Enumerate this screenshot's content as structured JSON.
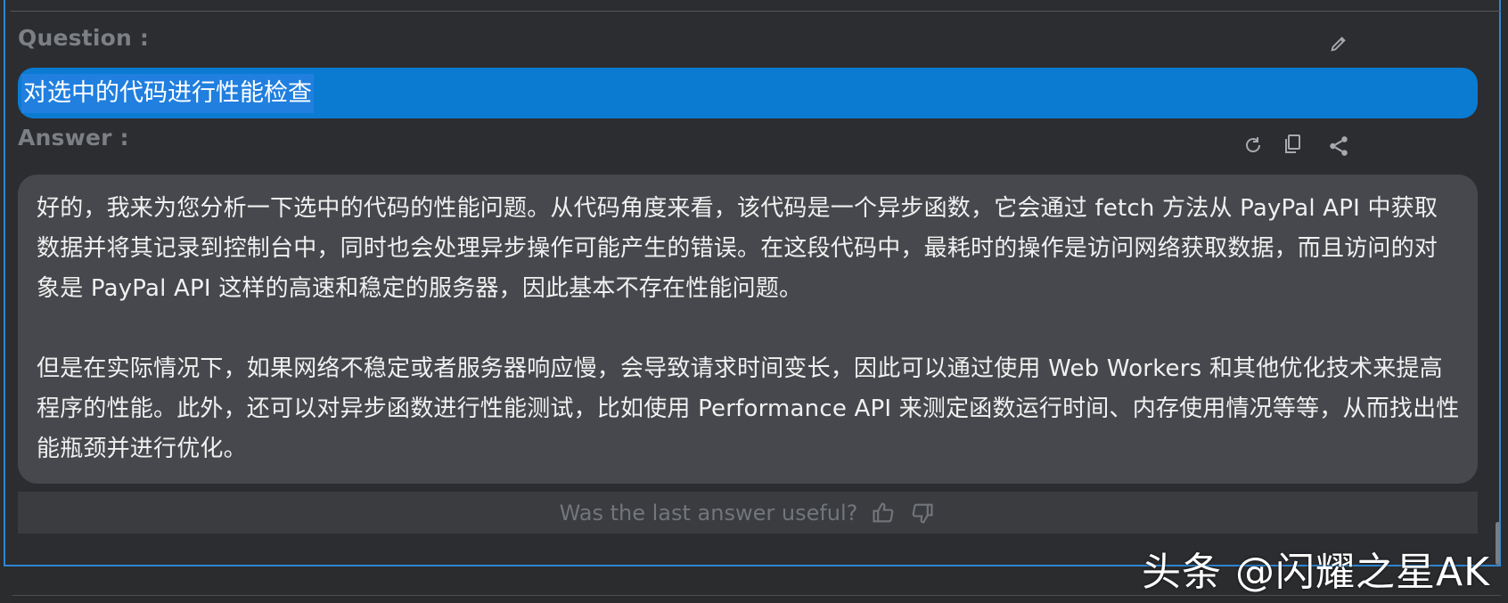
{
  "question": {
    "label": "Question :",
    "text": "对选中的代码进行性能检查"
  },
  "answer": {
    "label": "Answer :",
    "paragraphs": [
      "好的，我来为您分析一下选中的代码的性能问题。从代码角度来看，该代码是一个异步函数，它会通过 fetch 方法从 PayPal API 中获取数据并将其记录到控制台中，同时也会处理异步操作可能产生的错误。在这段代码中，最耗时的操作是访问网络获取数据，而且访问的对象是 PayPal API 这样的高速和稳定的服务器，因此基本不存在性能问题。",
      "但是在实际情况下，如果网络不稳定或者服务器响应慢，会导致请求时间变长，因此可以通过使用 Web Workers 和其他优化技术来提高程序的性能。此外，还可以对异步函数进行性能测试，比如使用 Performance API 来测定函数运行时间、内存使用情况等等，从而找出性能瓶颈并进行优化。"
    ]
  },
  "feedback": {
    "prompt": "Was the last answer useful?"
  },
  "watermark": "头条 @闪耀之星AK",
  "icons": {
    "edit": "pencil-icon",
    "regenerate": "refresh-icon",
    "copy": "copy-icon",
    "share": "share-icon",
    "thumbs_up": "thumbs-up-icon",
    "thumbs_down": "thumbs-down-icon"
  },
  "colors": {
    "accent": "#0b7bd2",
    "panel_border": "#2f86d1",
    "answer_bg": "#46484d"
  }
}
